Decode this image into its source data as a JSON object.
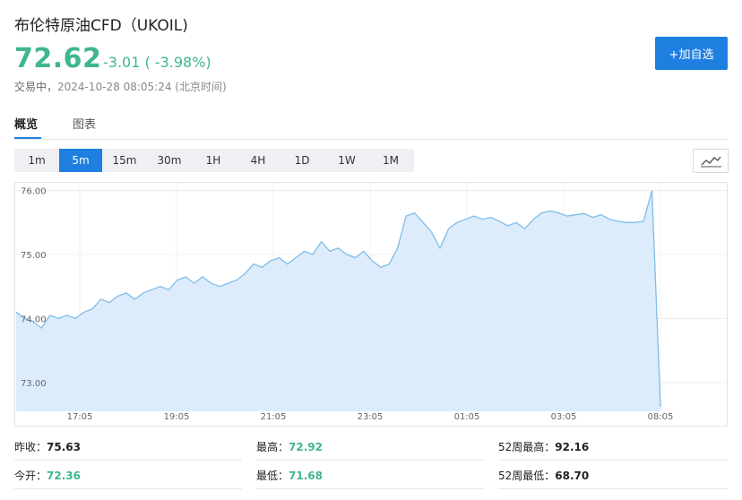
{
  "header": {
    "title": "布伦特原油CFD（UKOIL)",
    "price": "72.62",
    "change": "-3.01 ( -3.98%)",
    "status_label": "交易中，",
    "timestamp": "2024-10-28 08:05:24",
    "timezone": "(北京时间)",
    "add_button": "+加自选"
  },
  "tabs": [
    {
      "label": "概览",
      "active": true
    },
    {
      "label": "图表",
      "active": false
    }
  ],
  "ranges": [
    {
      "label": "1m",
      "active": false
    },
    {
      "label": "5m",
      "active": true
    },
    {
      "label": "15m",
      "active": false
    },
    {
      "label": "30m",
      "active": false
    },
    {
      "label": "1H",
      "active": false
    },
    {
      "label": "4H",
      "active": false
    },
    {
      "label": "1D",
      "active": false
    },
    {
      "label": "1W",
      "active": false
    },
    {
      "label": "1M",
      "active": false
    }
  ],
  "chart_type_icon": "line-chart-icon",
  "colors": {
    "accent": "#1f7fe0",
    "down": "#3fb68b",
    "line": "#7fbde8",
    "fill": "#dcecfb"
  },
  "chart_data": {
    "type": "area",
    "x_ticks": [
      "17:05",
      "19:05",
      "21:05",
      "23:05",
      "01:05",
      "03:05",
      "08:05"
    ],
    "y_ticks": [
      "76.00",
      "75.00",
      "74.00",
      "73.00"
    ],
    "ylim": [
      72.55,
      76.12
    ],
    "grid": true,
    "series": [
      {
        "points": [
          [
            0,
            74.1
          ],
          [
            1,
            74.0
          ],
          [
            2,
            73.95
          ],
          [
            3,
            73.85
          ],
          [
            4,
            74.05
          ],
          [
            5,
            74.0
          ],
          [
            6,
            74.05
          ],
          [
            7,
            74.0
          ],
          [
            8,
            74.1
          ],
          [
            9,
            74.15
          ],
          [
            10,
            74.3
          ],
          [
            11,
            74.25
          ],
          [
            12,
            74.35
          ],
          [
            13,
            74.4
          ],
          [
            14,
            74.3
          ],
          [
            15,
            74.4
          ],
          [
            16,
            74.45
          ],
          [
            17,
            74.5
          ],
          [
            18,
            74.45
          ],
          [
            19,
            74.6
          ],
          [
            20,
            74.65
          ],
          [
            21,
            74.55
          ],
          [
            22,
            74.65
          ],
          [
            23,
            74.55
          ],
          [
            24,
            74.5
          ],
          [
            25,
            74.55
          ],
          [
            26,
            74.6
          ],
          [
            27,
            74.7
          ],
          [
            28,
            74.85
          ],
          [
            29,
            74.8
          ],
          [
            30,
            74.9
          ],
          [
            31,
            74.95
          ],
          [
            32,
            74.85
          ],
          [
            33,
            74.95
          ],
          [
            34,
            75.05
          ],
          [
            35,
            75.0
          ],
          [
            36,
            75.2
          ],
          [
            37,
            75.05
          ],
          [
            38,
            75.1
          ],
          [
            39,
            75.0
          ],
          [
            40,
            74.95
          ],
          [
            41,
            75.05
          ],
          [
            42,
            74.9
          ],
          [
            43,
            74.8
          ],
          [
            44,
            74.85
          ],
          [
            45,
            75.1
          ],
          [
            46,
            75.6
          ],
          [
            47,
            75.65
          ],
          [
            48,
            75.5
          ],
          [
            49,
            75.35
          ],
          [
            50,
            75.1
          ],
          [
            51,
            75.4
          ],
          [
            52,
            75.5
          ],
          [
            53,
            75.55
          ],
          [
            54,
            75.6
          ],
          [
            55,
            75.55
          ],
          [
            56,
            75.58
          ],
          [
            57,
            75.52
          ],
          [
            58,
            75.45
          ],
          [
            59,
            75.5
          ],
          [
            60,
            75.4
          ],
          [
            61,
            75.55
          ],
          [
            62,
            75.65
          ],
          [
            63,
            75.68
          ],
          [
            64,
            75.65
          ],
          [
            65,
            75.6
          ],
          [
            66,
            75.62
          ],
          [
            67,
            75.64
          ],
          [
            68,
            75.58
          ],
          [
            69,
            75.62
          ],
          [
            70,
            75.55
          ],
          [
            71,
            75.52
          ],
          [
            72,
            75.5
          ],
          [
            73,
            75.5
          ],
          [
            74,
            75.52
          ],
          [
            75,
            76.0
          ],
          [
            76,
            72.62
          ]
        ]
      }
    ]
  },
  "stats": {
    "prev_close": {
      "label": "昨收：",
      "value": "75.63"
    },
    "high": {
      "label": "最高：",
      "value": "72.92"
    },
    "high_52w": {
      "label": "52周最高：",
      "value": "92.16"
    },
    "open": {
      "label": "今开：",
      "value": "72.36"
    },
    "low": {
      "label": "最低：",
      "value": "71.68"
    },
    "low_52w": {
      "label": "52周最低：",
      "value": "68.70"
    }
  }
}
